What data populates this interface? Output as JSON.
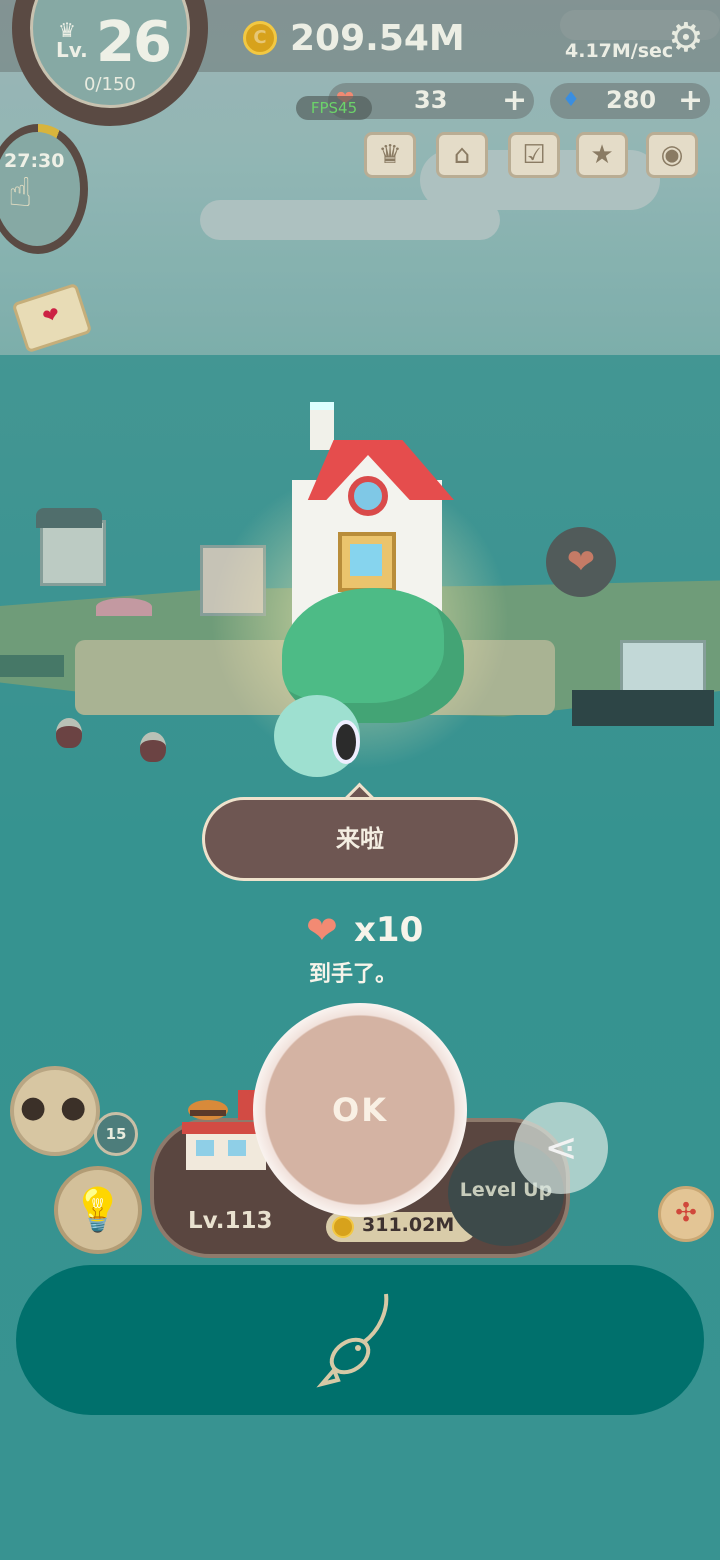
{
  "hud": {
    "level_prefix": "Lv.",
    "level": "26",
    "xp": "0/150",
    "coins": "209.54M",
    "rate": "4.17M/sec",
    "fps": "FPS45",
    "hearts": "33",
    "gems": "280",
    "plus": "+"
  },
  "left_panel": {
    "timer": "27:30"
  },
  "reward": {
    "speech": "来啦",
    "amount": "x10",
    "message": "到手了。",
    "ok_label": "OK"
  },
  "bottom": {
    "seal_count": "15",
    "shop_level": "Lv.113",
    "shop_price": "311.02M",
    "level_up_label": "Level Up"
  },
  "colors": {
    "accent_teal": "#00706c",
    "ok_button": "#d4b3a3",
    "bubble": "#6e5652",
    "heart": "#f28a73",
    "coin": "#d7a21c"
  },
  "icons": [
    "crown-icon",
    "coin-icon",
    "gear-icon",
    "heart-icon",
    "diamond-icon",
    "crown-menu-icon",
    "shop-icon",
    "checklist-icon",
    "trophy-icon",
    "camera-icon",
    "tap-hand-icon",
    "mail-icon",
    "seal-icon",
    "lightbulb-icon",
    "share-icon",
    "shrink-icon",
    "fish-hook-icon"
  ]
}
